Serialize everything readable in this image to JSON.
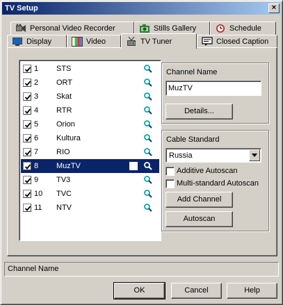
{
  "window": {
    "title": "TV Setup",
    "close_glyph": "×"
  },
  "tabs": [
    {
      "label": "Personal Video Recorder",
      "icon": "film-camera-icon"
    },
    {
      "label": "Stills Gallery",
      "icon": "camera-icon"
    },
    {
      "label": "Schedule",
      "icon": "clock-icon"
    },
    {
      "label": "Display",
      "icon": "monitor-icon"
    },
    {
      "label": "Video",
      "icon": "color-bars-icon"
    },
    {
      "label": "TV Tuner",
      "icon": "antenna-icon",
      "active": true
    },
    {
      "label": "Closed Caption",
      "icon": "caption-icon"
    }
  ],
  "channels": [
    {
      "num": "1",
      "name": "STS",
      "checked": true
    },
    {
      "num": "2",
      "name": "ORT",
      "checked": true
    },
    {
      "num": "3",
      "name": "Skat",
      "checked": true
    },
    {
      "num": "4",
      "name": "RTR",
      "checked": true
    },
    {
      "num": "5",
      "name": "Orion",
      "checked": true
    },
    {
      "num": "6",
      "name": "Kultura",
      "checked": true
    },
    {
      "num": "7",
      "name": "RIO",
      "checked": true
    },
    {
      "num": "8",
      "name": "MuzTV",
      "checked": true,
      "selected": true
    },
    {
      "num": "9",
      "name": "TV3",
      "checked": true
    },
    {
      "num": "10",
      "name": "TVC",
      "checked": true
    },
    {
      "num": "11",
      "name": "NTV",
      "checked": true
    }
  ],
  "channel_name_group": {
    "label": "Channel Name",
    "value": "MuzTV",
    "details_button": "Details..."
  },
  "cable_group": {
    "label": "Cable Standard",
    "selected": "Russia",
    "additive_autoscan": {
      "label": "Additive Autoscan",
      "checked": false
    },
    "multi_standard_autoscan": {
      "label": "Multi-standard Autoscan",
      "checked": false
    },
    "add_channel_button": "Add Channel",
    "autoscan_button": "Autoscan"
  },
  "status": {
    "text": "Channel Name"
  },
  "buttons": {
    "ok": "OK",
    "cancel": "Cancel",
    "help": "Help"
  },
  "colors": {
    "face": "#d4d0c8",
    "selection": "#0a246a",
    "title_gradient_start": "#0a246a",
    "title_gradient_end": "#a6caf0",
    "magnifier": "#0aa8a0"
  }
}
